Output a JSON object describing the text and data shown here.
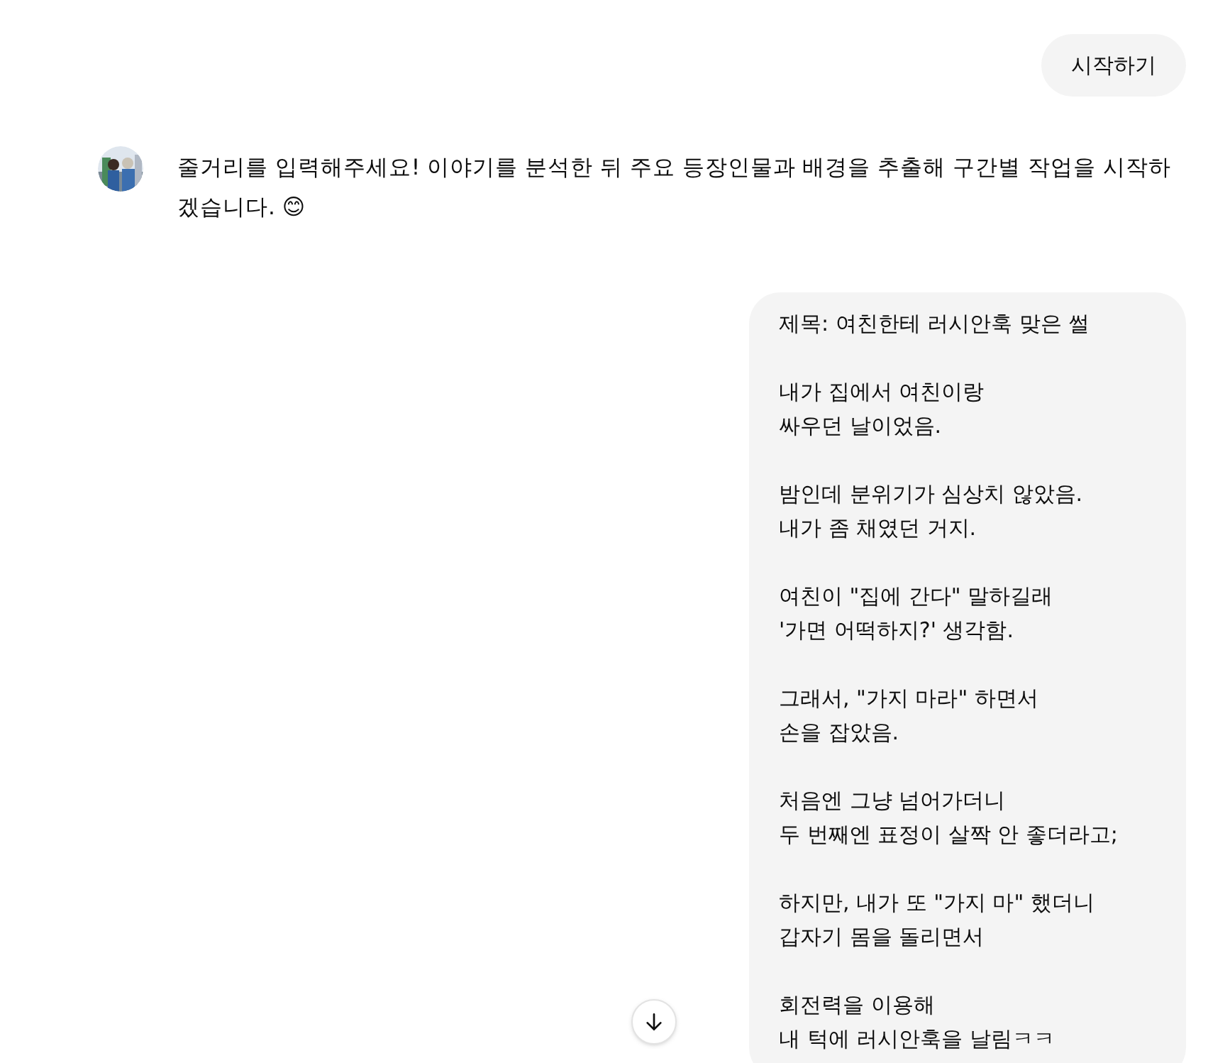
{
  "messages": [
    {
      "kind": "sent",
      "paragraphs": [
        "시작하기"
      ]
    },
    {
      "kind": "reply",
      "paragraphs": [
        "줄거리를 입력해주세요! 이야기를 분석한 뒤 주요 등장인물과 배경을 추출해 구간별 작업을 시작하겠습니다. 😊"
      ]
    },
    {
      "kind": "sent",
      "paragraphs": [
        "제목: 여친한테 러시안훅 맞은 썰",
        "내가 집에서 여친이랑\n싸우던 날이었음.",
        "밤인데 분위기가 심상치 않았음.\n내가 좀 채였던 거지.",
        "여친이 \"집에 간다\" 말하길래\n'가면 어떡하지?' 생각함.",
        "그래서, \"가지 마라\" 하면서\n손을 잡았음.",
        "처음엔 그냥 넘어가더니\n두 번째엔 표정이 살짝 안 좋더라고;",
        "하지만, 내가 또 \"가지 마\" 했더니\n갑자기 몸을 돌리면서",
        "회전력을 이용해\n내 턱에 러시안훅을 날림ㅋㅋ"
      ]
    }
  ]
}
